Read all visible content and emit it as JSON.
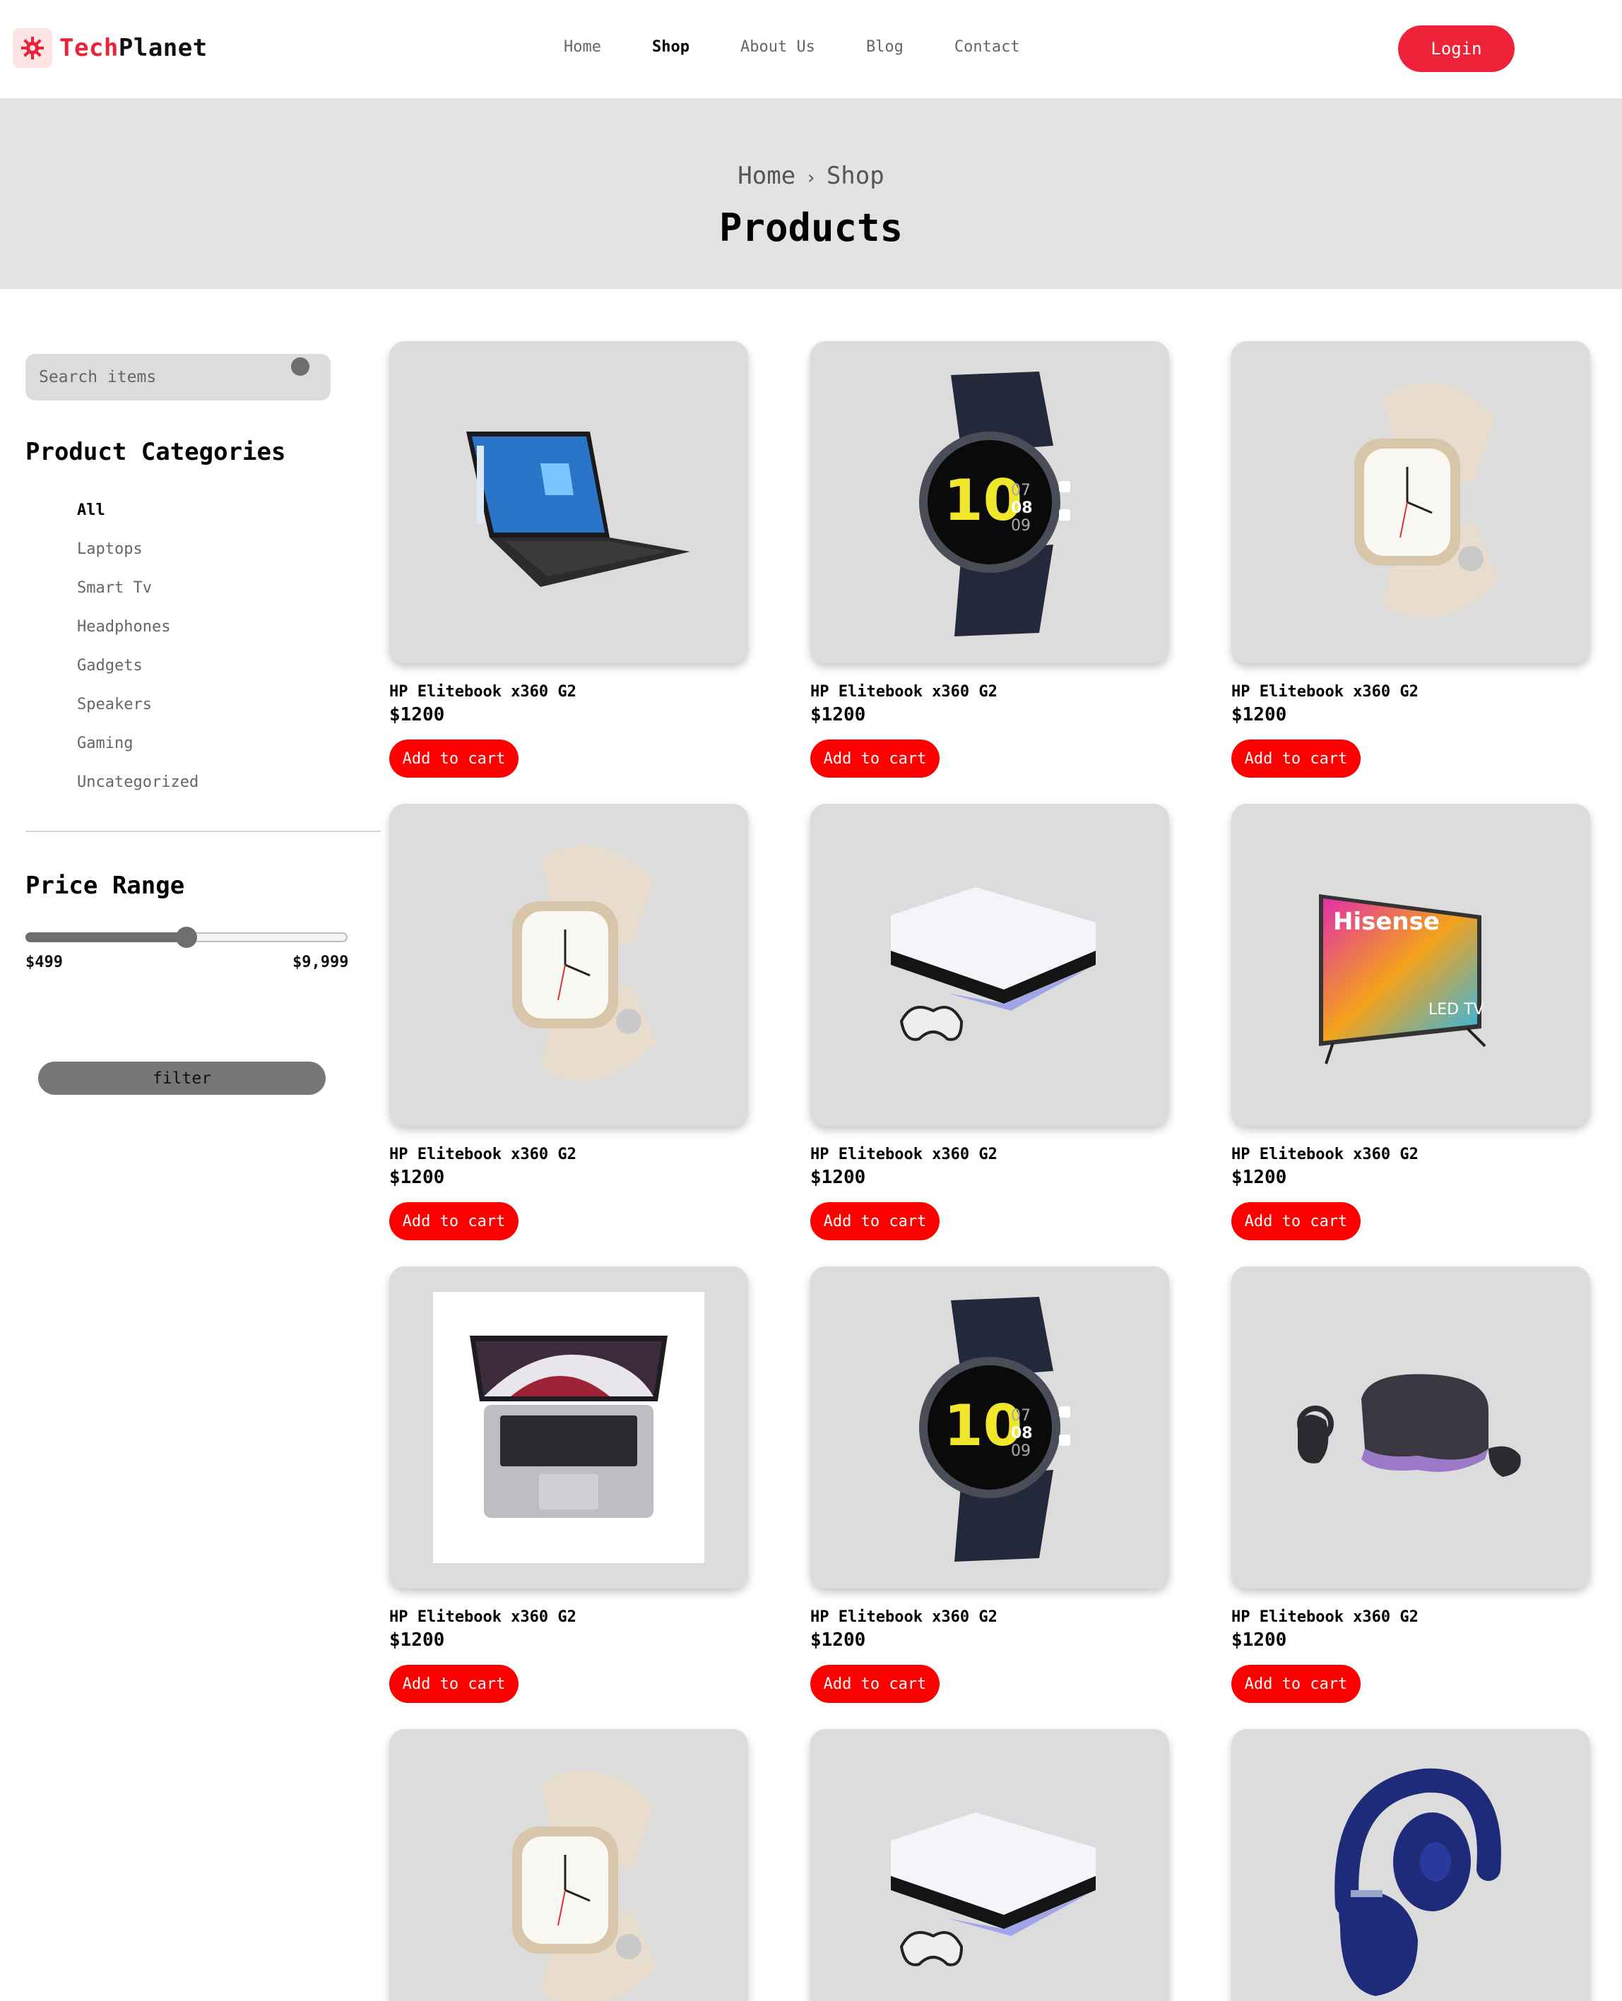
{
  "header": {
    "logo_brand_part1": "Tech",
    "logo_brand_part2": "Planet",
    "nav": [
      "Home",
      "Shop",
      "About Us",
      "Blog",
      "Contact"
    ],
    "nav_active": "Shop",
    "login_label": "Login"
  },
  "banner": {
    "breadcrumb_home": "Home",
    "breadcrumb_separator": "›",
    "breadcrumb_current": "Shop",
    "title": "Products"
  },
  "sidebar": {
    "search_placeholder": "Search items",
    "categories_heading": "Product Categories",
    "categories": [
      "All",
      "Laptops",
      "Smart Tv",
      "Headphones",
      "Gadgets",
      "Speakers",
      "Gaming",
      "Uncategorized"
    ],
    "categories_active": "All",
    "price_heading": "Price Range",
    "price_min_label": "$499",
    "price_max_label": "$9,999",
    "price_slider_fraction": 0.5,
    "filter_label": "filter"
  },
  "products": [
    {
      "name": "HP Elitebook x360 G2",
      "price": "$1200",
      "cart_label": "Add to cart",
      "image": "laptop-icon"
    },
    {
      "name": "HP Elitebook x360 G2",
      "price": "$1200",
      "cart_label": "Add to cart",
      "image": "smartwatch-dark-icon"
    },
    {
      "name": "HP Elitebook x360 G2",
      "price": "$1200",
      "cart_label": "Add to cart",
      "image": "smartwatch-light-icon"
    },
    {
      "name": "HP Elitebook x360 G2",
      "price": "$1200",
      "cart_label": "Add to cart",
      "image": "smartwatch-light-icon"
    },
    {
      "name": "HP Elitebook x360 G2",
      "price": "$1200",
      "cart_label": "Add to cart",
      "image": "game-console-icon"
    },
    {
      "name": "HP Elitebook x360 G2",
      "price": "$1200",
      "cart_label": "Add to cart",
      "image": "smart-tv-icon"
    },
    {
      "name": "HP Elitebook x360 G2",
      "price": "$1200",
      "cart_label": "Add to cart",
      "image": "macbook-icon"
    },
    {
      "name": "HP Elitebook x360 G2",
      "price": "$1200",
      "cart_label": "Add to cart",
      "image": "smartwatch-dark-icon"
    },
    {
      "name": "HP Elitebook x360 G2",
      "price": "$1200",
      "cart_label": "Add to cart",
      "image": "vr-headset-icon"
    },
    {
      "name": "",
      "price": "",
      "cart_label": "",
      "image": "smartwatch-light-icon"
    },
    {
      "name": "",
      "price": "",
      "cart_label": "",
      "image": "game-console-icon"
    },
    {
      "name": "",
      "price": "",
      "cart_label": "",
      "image": "headphones-icon"
    }
  ],
  "tv_brand": "Hisense",
  "tv_badge": "LED TV",
  "colors": {
    "brand_red": "#e8243a",
    "login_bg": "#ee2339",
    "cart_button": "#fe0000",
    "card_bg": "#dcdcdc",
    "banner_bg": "#e3e3e3"
  }
}
